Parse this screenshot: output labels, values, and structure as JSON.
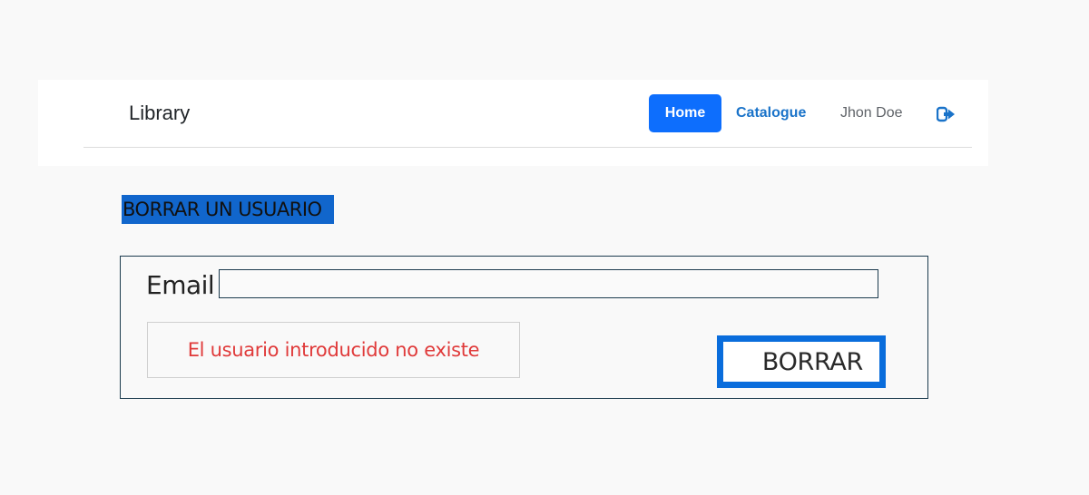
{
  "navbar": {
    "brand": "Library",
    "links": {
      "home": "Home",
      "catalogue": "Catalogue",
      "user": "Jhon Doe"
    },
    "logout_icon": "logout-icon"
  },
  "page": {
    "title": "BORRAR UN USUARIO"
  },
  "form": {
    "email_label": "Email",
    "email_value": "",
    "email_placeholder": "",
    "error_message": "El usuario introducido no existe",
    "submit_label": "BORRAR"
  },
  "colors": {
    "primary": "#0d6efd",
    "title_highlight": "#1166cc",
    "error": "#e03a3a",
    "form_border": "#1c3b4e"
  }
}
